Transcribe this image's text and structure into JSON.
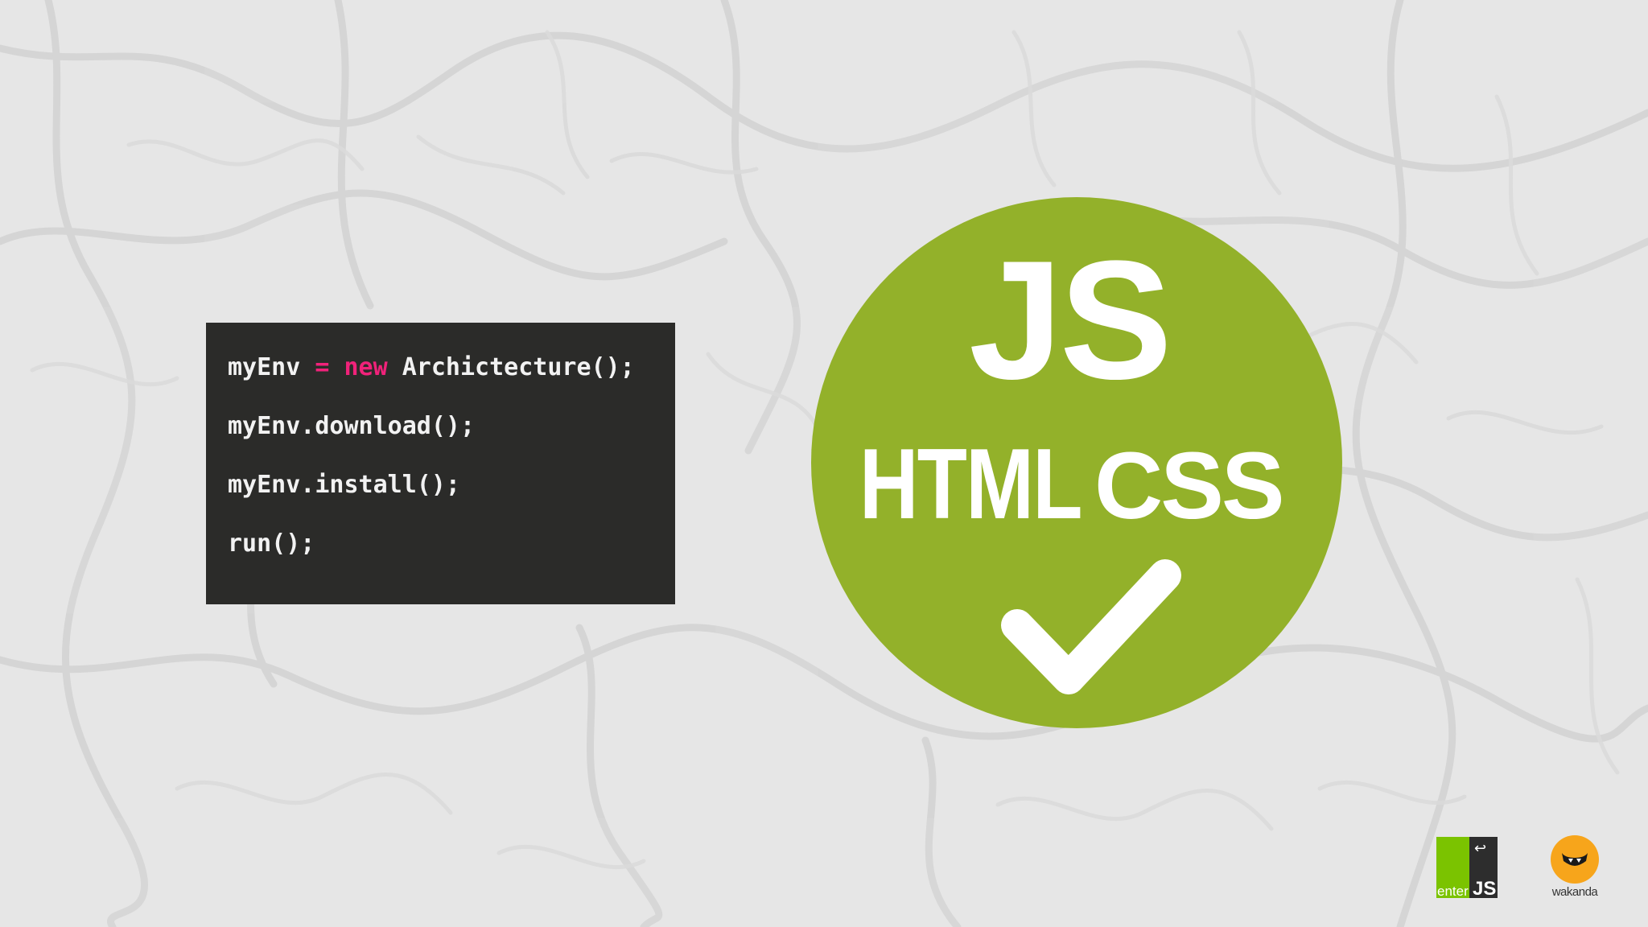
{
  "code": {
    "lines": [
      {
        "pre": "myEnv ",
        "op": "=",
        "mid": " ",
        "kw": "new",
        "post": " Archictecture();"
      },
      {
        "text": "myEnv.download();"
      },
      {
        "text": "myEnv.install();"
      },
      {
        "text": "run();"
      }
    ]
  },
  "badge": {
    "primary": "JS",
    "secondary_left": "HTML",
    "secondary_right": "CSS",
    "icon": "checkmark-icon",
    "color": "#93b12a"
  },
  "logos": {
    "enterjs": {
      "enter": "enter",
      "js": "JS",
      "arrow": "↩",
      "green": "#7bc300"
    },
    "wakanda": {
      "label": "wakanda",
      "color": "#f7a51b"
    }
  },
  "colors": {
    "background": "#e6e6e6",
    "code_background": "#2b2b29",
    "code_text": "#f2f2f2",
    "code_keyword": "#f0227a"
  }
}
